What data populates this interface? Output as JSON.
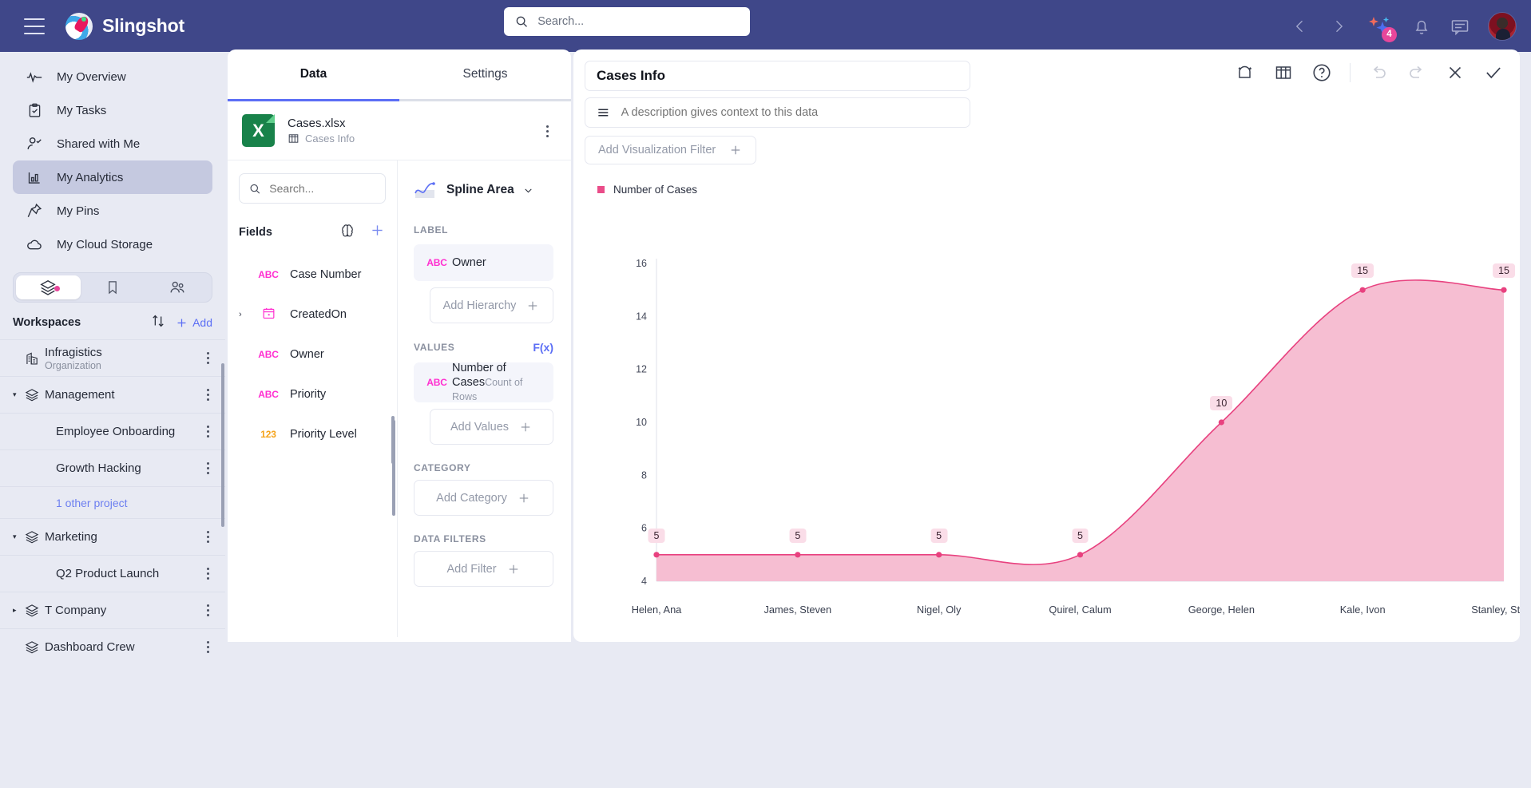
{
  "app": {
    "brand": "Slingshot",
    "menu_icon": "hamburger-icon"
  },
  "search": {
    "placeholder": "Search...",
    "value": ""
  },
  "topbar": {
    "back_icon": "chevron-left-icon",
    "forward_icon": "chevron-right-icon",
    "ai_icon": "sparkle-icon",
    "ai_badge": "4",
    "notifications_icon": "bell-icon",
    "chat_icon": "chat-icon",
    "avatar": "user-avatar"
  },
  "sidebar": {
    "nav": [
      {
        "label": "My Overview",
        "icon": "activity-icon",
        "active": false
      },
      {
        "label": "My Tasks",
        "icon": "clipboard-check-icon",
        "active": false
      },
      {
        "label": "Shared with Me",
        "icon": "user-shared-icon",
        "active": false
      },
      {
        "label": "My Analytics",
        "icon": "bar-chart-icon",
        "active": true
      },
      {
        "label": "My Pins",
        "icon": "pin-icon",
        "active": false
      },
      {
        "label": "My Cloud Storage",
        "icon": "cloud-icon",
        "active": false
      }
    ],
    "segments": [
      {
        "icon": "layers-icon",
        "active": true,
        "dot": true
      },
      {
        "icon": "bookmark-icon",
        "active": false,
        "dot": false
      },
      {
        "icon": "people-icon",
        "active": false,
        "dot": false
      }
    ],
    "workspaces_title": "Workspaces",
    "sort_icon": "sort-arrows-icon",
    "add_label": "Add",
    "add_icon": "plus-icon",
    "workspaces": [
      {
        "label": "Infragistics",
        "sub": "Organization",
        "icon": "building-icon",
        "caret": "",
        "kebab": true
      },
      {
        "label": "Management",
        "sub": "",
        "icon": "layers-icon",
        "caret": "expanded",
        "kebab": true
      },
      {
        "label": "Employee Onboarding",
        "sub": "",
        "icon": "",
        "caret": "",
        "kebab": true,
        "child": true
      },
      {
        "label": "Growth Hacking",
        "sub": "",
        "icon": "",
        "caret": "",
        "kebab": true,
        "child": true
      },
      {
        "label": "1 other project",
        "sub": "",
        "icon": "",
        "caret": "",
        "kebab": false,
        "link": true
      },
      {
        "label": "Marketing",
        "sub": "",
        "icon": "layers-icon",
        "caret": "expanded",
        "kebab": true
      },
      {
        "label": "Q2 Product Launch",
        "sub": "",
        "icon": "",
        "caret": "",
        "kebab": true,
        "child": true
      },
      {
        "label": "T Company",
        "sub": "",
        "icon": "layers-icon",
        "caret": "collapsed",
        "kebab": true
      },
      {
        "label": "Dashboard Crew",
        "sub": "",
        "icon": "layers-icon",
        "caret": "",
        "kebab": true
      }
    ]
  },
  "data_panel": {
    "tabs": [
      {
        "label": "Data",
        "active": true
      },
      {
        "label": "Settings",
        "active": false
      }
    ],
    "file": {
      "name": "Cases.xlsx",
      "sheet": "Cases Info",
      "icon_letter": "X",
      "sheet_icon": "table-icon",
      "kebab_icon": "more-vertical-icon"
    },
    "field_search_placeholder": "Search...",
    "fields_title": "Fields",
    "brain_icon": "brain-icon",
    "add_field_icon": "plus-icon",
    "fields": [
      {
        "name": "Case Number",
        "type": "ABC",
        "expandable": false
      },
      {
        "name": "CreatedOn",
        "type": "DATE",
        "expandable": true
      },
      {
        "name": "Owner",
        "type": "ABC",
        "expandable": false
      },
      {
        "name": "Priority",
        "type": "ABC",
        "expandable": false
      },
      {
        "name": "Priority Level",
        "type": "123",
        "expandable": false
      }
    ]
  },
  "config": {
    "viz_type": "Spline Area",
    "viz_icon": "spline-area-icon",
    "viz_caret": "chevron-down-icon",
    "sections": [
      {
        "label": "LABEL",
        "action": "",
        "chips": [
          {
            "type": "ABC",
            "name": "Owner",
            "sub": ""
          }
        ],
        "dropzone": "Add Hierarchy",
        "dropzone_indented": true
      },
      {
        "label": "VALUES",
        "action": "F(x)",
        "chips": [
          {
            "type": "ABC",
            "name": "Number of Cases",
            "sub": "Count of Rows"
          }
        ],
        "dropzone": "Add Values",
        "dropzone_indented": true
      },
      {
        "label": "CATEGORY",
        "action": "",
        "chips": [],
        "dropzone": "Add Category",
        "dropzone_indented": false
      },
      {
        "label": "DATA FILTERS",
        "action": "",
        "chips": [],
        "dropzone": "Add Filter",
        "dropzone_indented": false
      }
    ]
  },
  "chart_panel": {
    "title": "Cases Info",
    "description_placeholder": "A description gives context to this data",
    "description_icon": "lines-icon",
    "filter_label": "Add Visualization Filter",
    "filter_icon": "plus-icon",
    "tools": [
      {
        "icon": "add-visual-icon"
      },
      {
        "icon": "table-icon"
      },
      {
        "icon": "help-icon"
      },
      {
        "icon": "divider"
      },
      {
        "icon": "undo-icon"
      },
      {
        "icon": "redo-icon"
      },
      {
        "icon": "close-icon"
      },
      {
        "icon": "check-icon"
      }
    ]
  },
  "chart_data": {
    "type": "area",
    "title": "Cases Info",
    "series_name": "Number of Cases",
    "legend": [
      "Number of Cases"
    ],
    "legend_position": "top-left",
    "categories": [
      "Helen, Ana",
      "James, Steven",
      "Nigel, Oly",
      "Quirel, Calum",
      "George, Helen",
      "Kale, Ivon",
      "Stanley, Steve"
    ],
    "values": [
      5,
      5,
      5,
      5,
      10,
      15,
      15
    ],
    "point_labels": [
      "5",
      "5",
      "5",
      "5",
      "10",
      "15",
      "15"
    ],
    "xlabel": "",
    "ylabel": "",
    "ylim": [
      4,
      16
    ],
    "yticks": [
      4,
      6,
      8,
      10,
      12,
      14,
      16
    ],
    "grid": false,
    "line_color": "#e8417f",
    "fill_color": "#f6bed2",
    "marker_color": "#e8417f",
    "label_bg": "#fadde8"
  }
}
